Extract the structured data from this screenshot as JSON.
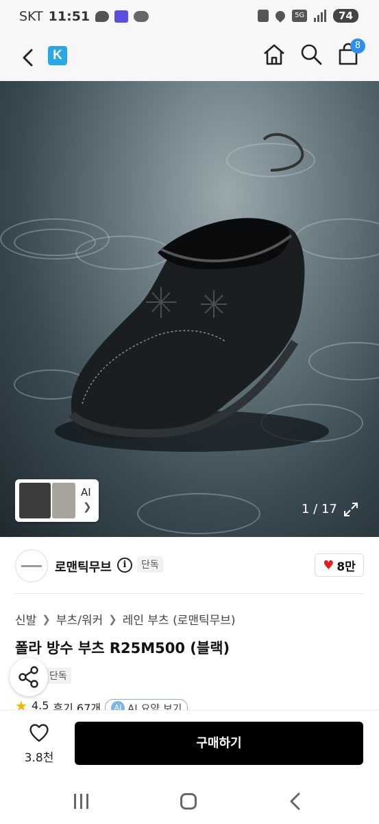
{
  "status_bar": {
    "carrier": "SKT",
    "time": "11:51",
    "network": "5G",
    "battery": "74"
  },
  "header": {
    "app_logo_letter": "K",
    "cart_count": "8"
  },
  "gallery": {
    "counter": "1 / 17",
    "ai_label": "AI"
  },
  "brand": {
    "name": "로맨틱무브",
    "badge": "단독",
    "likes": "8만"
  },
  "breadcrumb": [
    "신발",
    "부츠/워커",
    "레인 부츠 (로맨틱무브)"
  ],
  "product": {
    "title": "폴라 방수 부츠 R25M500 (블랙)",
    "badge": "단독",
    "rating": "4.5",
    "reviews": "후기 67개",
    "ai_summary": "AI 요약 보기"
  },
  "bottom": {
    "wishlist_count": "3.8천",
    "buy_label": "구매하기"
  },
  "colors": {
    "accent_blue": "#2c8ef0",
    "buy_button": "#000000",
    "heart": "#e02020"
  }
}
